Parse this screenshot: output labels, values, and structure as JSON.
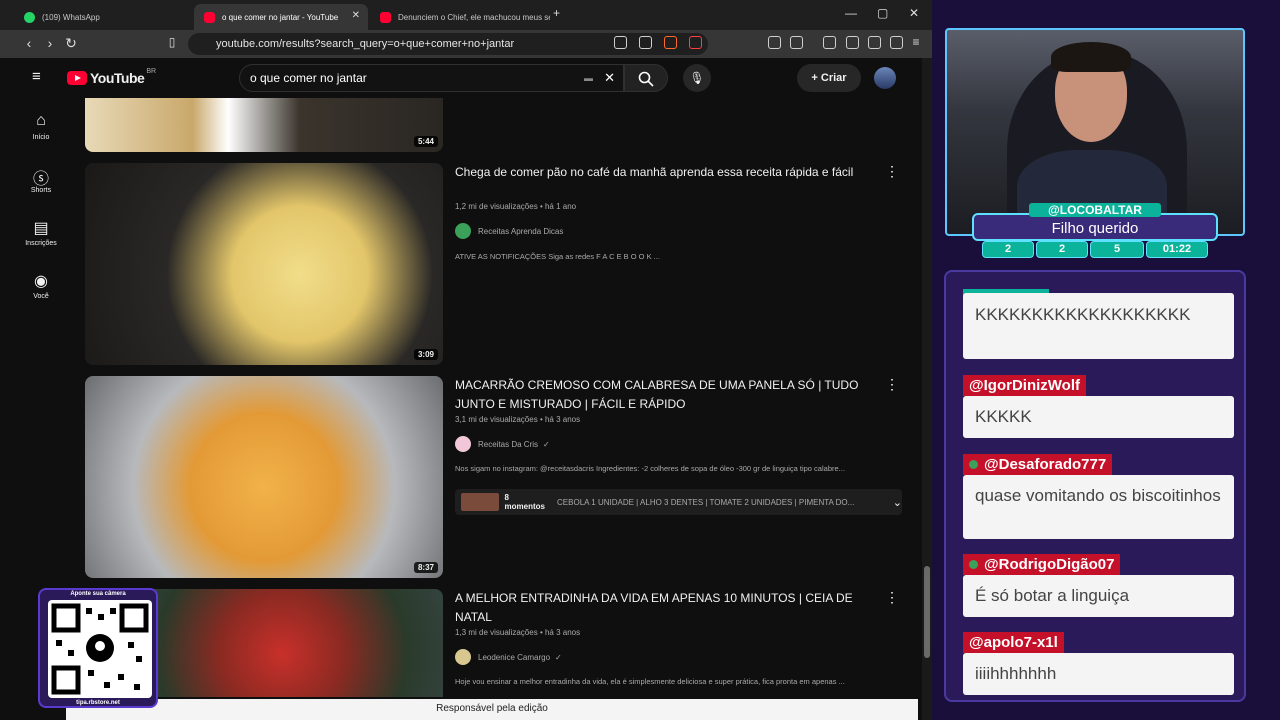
{
  "browser": {
    "tabs": [
      {
        "label": "(109) WhatsApp",
        "active": false
      },
      {
        "label": "o que comer no jantar - YouTube",
        "active": true
      },
      {
        "label": "Denunciem o Chief, ele machucou meus sen...",
        "active": false
      }
    ],
    "url": "youtube.com/results?search_query=o+que+comer+no+jantar",
    "new_tab_icon": "plus-icon"
  },
  "youtube": {
    "logo_text": "YouTube",
    "country_code": "BR",
    "search_value": "o que comer no jantar",
    "create_label": "Criar",
    "sidenav": [
      {
        "label": "Início",
        "icon": "home-icon"
      },
      {
        "label": "Shorts",
        "icon": "shorts-icon"
      },
      {
        "label": "Inscrições",
        "icon": "subscriptions-icon"
      },
      {
        "label": "Você",
        "icon": "you-icon"
      }
    ],
    "results": [
      {
        "duration": "5:44"
      },
      {
        "title": "Chega de comer pão no café da manhã aprenda essa receita rápida e fácil",
        "views": "1,2 mi de visualizações",
        "age": "há 1 ano",
        "channel": "Receitas Aprenda Dicas",
        "description": "ATIVE AS NOTIFICAÇÕES Siga as redes F A C E B O O K ...",
        "duration": "3:09"
      },
      {
        "title": "MACARRÃO CREMOSO COM CALABRESA DE UMA PANELA SÓ | TUDO JUNTO E MISTURADO | FÁCIL E RÁPIDO",
        "views": "3,1 mi de visualizações",
        "age": "há 3 anos",
        "channel": "Receitas Da Cris",
        "description": "Nos sigam no instagram: @receitasdacris Ingredientes: -2 colheres de sopa de óleo -300 gr de linguiça tipo calabre...",
        "duration": "8:37",
        "moments_label": "8 momentos",
        "moments_text": "CEBOLA 1 UNIDADE | ALHO 3 DENTES | TOMATE 2 UNIDADES | PIMENTA DO..."
      },
      {
        "title": "A MELHOR ENTRADINHA DA VIDA EM APENAS 10 MINUTOS | CEIA DE NATAL",
        "views": "1,3 mi de visualizações",
        "age": "há 3 anos",
        "channel": "Leodenice Camargo",
        "description": "Hoje vou ensinar a melhor entradinha da vida, ela é simplesmente deliciosa e super prática, fica pronta em apenas ..."
      }
    ],
    "bottom_bar": "Responsável pela edição"
  },
  "stream": {
    "qr_top": "Aponte sua câmera",
    "qr_bottom": "tipa.rbstore.net",
    "handle": "@LOCOBALTAR",
    "caption": "Filho querido",
    "stats": [
      "2",
      "2",
      "5",
      "01:22"
    ],
    "chat": [
      {
        "user": "",
        "text": "KKKKKKKKKKKKKKKKKKK"
      },
      {
        "user": "@IgorDinizWolf",
        "text": "KKKKK"
      },
      {
        "user": "@Desaforado777",
        "text": "quase vomitando os biscoitinhos"
      },
      {
        "user": "@RodrigoDigão07",
        "text": "É só botar a linguiça"
      },
      {
        "user": "@apolo7-x1l",
        "text": "iiiihhhhhhh"
      }
    ]
  }
}
